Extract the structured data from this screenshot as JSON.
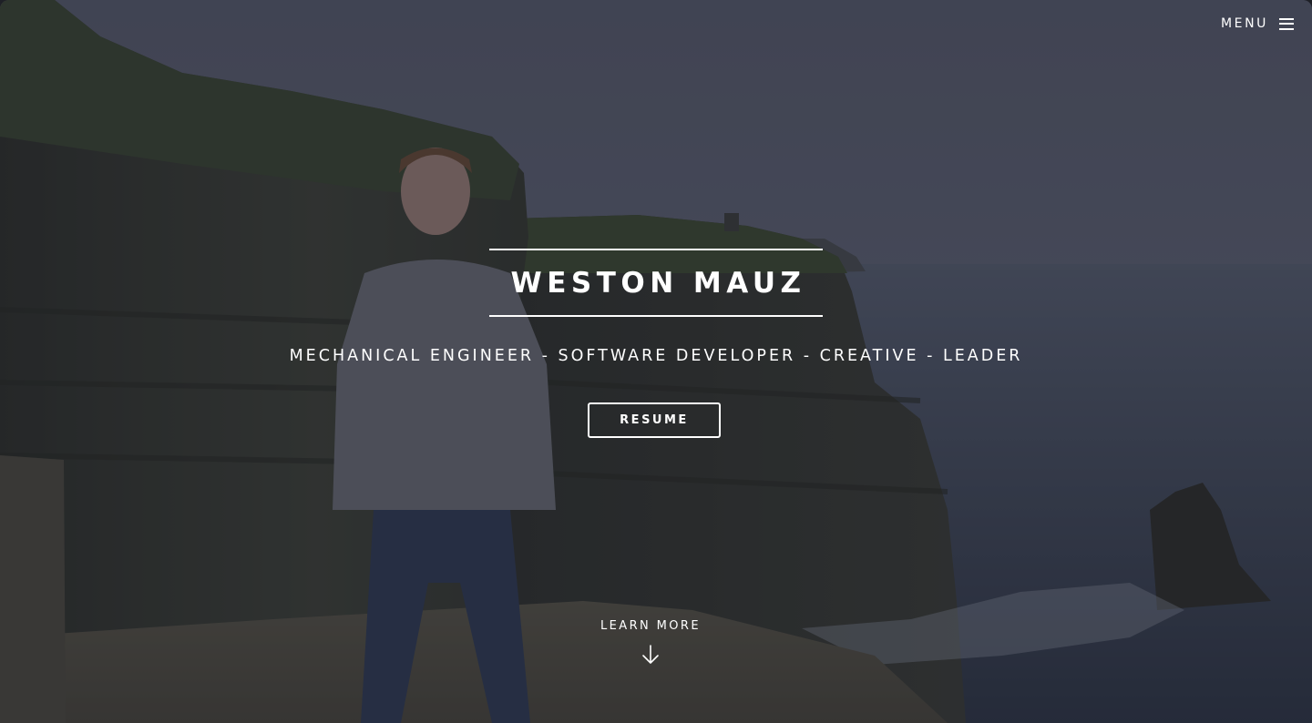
{
  "nav": {
    "menu_label": "MENU",
    "menu_icon": "hamburger-menu-icon"
  },
  "hero": {
    "name": "WESTON MAUZ",
    "tagline": "MECHANICAL ENGINEER - SOFTWARE DEVELOPER - CREATIVE - LEADER",
    "resume_label": "RESUME",
    "learn_more_label": "LEARN MORE",
    "learn_more_icon": "arrow-down-icon",
    "background": "cliffs-of-moher-portrait-photo"
  },
  "colors": {
    "text": "#ffffff",
    "overlay": "#1c1f2a",
    "sky": "#6a6e80",
    "sea": "#3e4658",
    "cliff": "#3a3d33"
  }
}
